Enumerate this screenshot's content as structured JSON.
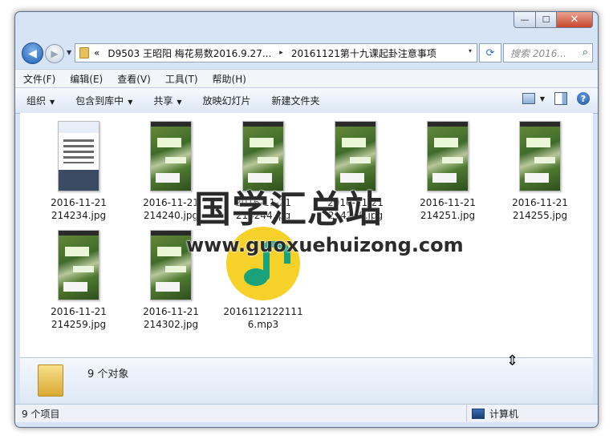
{
  "window": {
    "min_label": "—",
    "max_label": "☐",
    "close_label": "✕"
  },
  "nav": {
    "back_icon": "◀",
    "forward_icon": "▶",
    "history_icon": "▼"
  },
  "address": {
    "chevron": "«",
    "segments": [
      "D9503 王昭阳 梅花易数2016.9.27...",
      "20161121第十九课起卦注意事项"
    ],
    "separator": "▸",
    "dropdown": "▾"
  },
  "refresh_icon": "⟳",
  "search": {
    "placeholder": "搜索 2016...",
    "icon": "⌕"
  },
  "menu": [
    "文件(F)",
    "编辑(E)",
    "查看(V)",
    "工具(T)",
    "帮助(H)"
  ],
  "toolbar": {
    "organize": "组织",
    "include_library": "包含到库中",
    "share": "共享",
    "slideshow": "放映幻灯片",
    "new_folder": "新建文件夹",
    "arrow": "▼",
    "help_label": "?"
  },
  "files": [
    {
      "name": "2016-11-21\n214234.jpg",
      "thumb": "ui"
    },
    {
      "name": "2016-11-21\n214240.jpg",
      "thumb": "green"
    },
    {
      "name": "2016-11-21\n214244.jpg",
      "thumb": "green"
    },
    {
      "name": "2016-11-21\n214248.jpg",
      "thumb": "green"
    },
    {
      "name": "2016-11-21\n214251.jpg",
      "thumb": "green"
    },
    {
      "name": "2016-11-21\n214255.jpg",
      "thumb": "green"
    },
    {
      "name": "2016-11-21\n214259.jpg",
      "thumb": "green"
    },
    {
      "name": "2016-11-21\n214302.jpg",
      "thumb": "green"
    },
    {
      "name": "2016112122111\n6.mp3",
      "thumb": "music-icon"
    }
  ],
  "details": {
    "text": "9 个对象"
  },
  "status": {
    "left": "9 个项目",
    "right": "计算机"
  },
  "cursor_icon": "⇕",
  "watermark": {
    "cn": "国学汇总站",
    "en": "www.guoxuehuizong.com"
  }
}
